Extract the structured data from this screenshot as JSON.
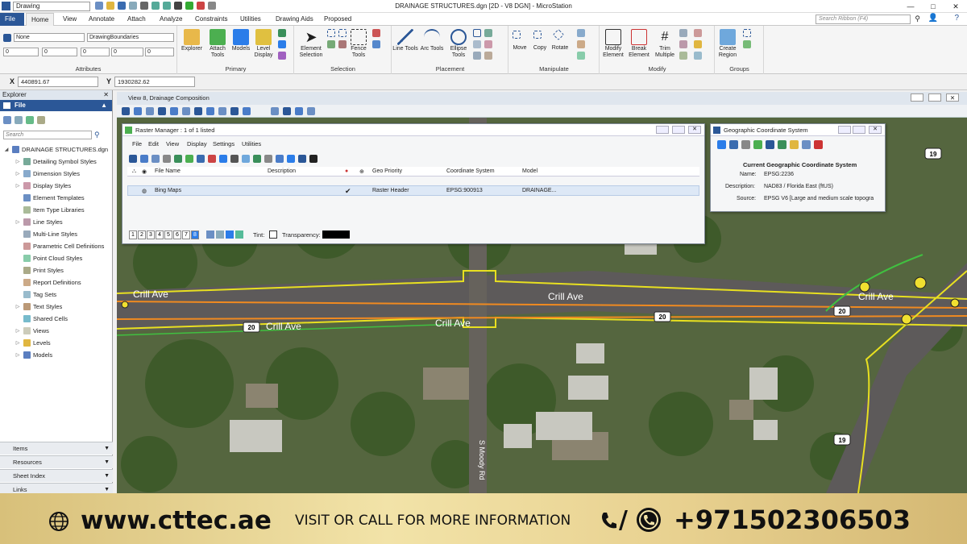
{
  "titlebar": {
    "workspace": "Drawing",
    "app_title": "DRAINAGE STRUCTURES.dgn [2D - V8 DGN] - MicroStation"
  },
  "tabs": [
    "File",
    "Home",
    "View",
    "Annotate",
    "Attach",
    "Analyze",
    "Constraints",
    "Utilities",
    "Drawing Aids",
    "Proposed"
  ],
  "search_placeholder": "Search Ribbon (F4)",
  "attributes": {
    "level": "None",
    "style": "DrawingBoundaries",
    "color": "0",
    "weight": "0",
    "linestyle": "0",
    "priority": "0",
    "transparency": "0",
    "label": "Attributes"
  },
  "groups": {
    "primary": {
      "label": "Primary",
      "buttons": [
        "Explorer",
        "Attach Tools",
        "Models",
        "Level Display"
      ]
    },
    "selection": {
      "label": "Selection",
      "buttons": [
        "Element Selection",
        "Fence Tools"
      ]
    },
    "placement": {
      "label": "Placement",
      "buttons": [
        "Line Tools",
        "Arc Tools",
        "Ellipse Tools"
      ]
    },
    "manipulate": {
      "label": "Manipulate",
      "buttons": [
        "Move",
        "Copy",
        "Rotate"
      ]
    },
    "modify": {
      "label": "Modify",
      "buttons": [
        "Modify Element",
        "Break Element",
        "Trim Multiple"
      ]
    },
    "groups": {
      "label": "Groups",
      "buttons": [
        "Create Region"
      ]
    }
  },
  "coords": {
    "x_label": "X",
    "x_value": "440891.67",
    "y_label": "Y",
    "y_value": "1930282.62"
  },
  "explorer": {
    "title": "Explorer",
    "section": "File",
    "search": "Search",
    "root": "DRAINAGE STRUCTURES.dgn",
    "items": [
      "Detailing Symbol Styles",
      "Dimension Styles",
      "Display Styles",
      "Element Templates",
      "Item Type Libraries",
      "Line Styles",
      "Multi-Line Styles",
      "Parametric Cell Definitions",
      "Point Cloud Styles",
      "Print Styles",
      "Report Definitions",
      "Tag Sets",
      "Text Styles",
      "Shared Cells",
      "Views",
      "Levels",
      "Models"
    ],
    "panels": [
      "Items",
      "Resources",
      "Sheet Index",
      "Links"
    ]
  },
  "view": {
    "title": "View 8, Drainage Composition"
  },
  "raster_manager": {
    "title": "Raster Manager : 1 of 1 listed",
    "menu": [
      "File",
      "Edit",
      "View",
      "Display",
      "Settings",
      "Utilities"
    ],
    "columns": [
      "File Name",
      "Description",
      "Geo Priority",
      "Coordinate System",
      "Model"
    ],
    "row": {
      "file": "Bing Maps",
      "check": "✔",
      "geo_priority": "Raster Header",
      "coord_sys": "EPSG:900913",
      "model": "DRAINAGE..."
    },
    "pages": [
      "1",
      "2",
      "3",
      "4",
      "5",
      "6",
      "7",
      "8"
    ],
    "tint_label": "Tint:",
    "transparency_label": "Transparency:"
  },
  "gcs": {
    "title": "Geographic Coordinate System",
    "heading": "Current Geographic Coordinate System",
    "name_label": "Name:",
    "name": "EPSG:2236",
    "desc_label": "Description:",
    "desc": "NAD83 / Florida East (ftUS)",
    "source_label": "Source:",
    "source": "EPSG V6 [Large and medium scale topogra"
  },
  "map": {
    "street1": "Crill Ave",
    "street2": "Crill Ave",
    "street3": "Crill Ave",
    "street4": "Crill Ave",
    "street5": "Crill Ave",
    "route20": "20",
    "route19": "19",
    "moody": "S Moody Rd"
  },
  "footer": {
    "url": "www.cttec.ae",
    "visit": "VISIT OR CALL FOR MORE INFORMATION",
    "sep": "/",
    "phone": "+971502306503"
  }
}
